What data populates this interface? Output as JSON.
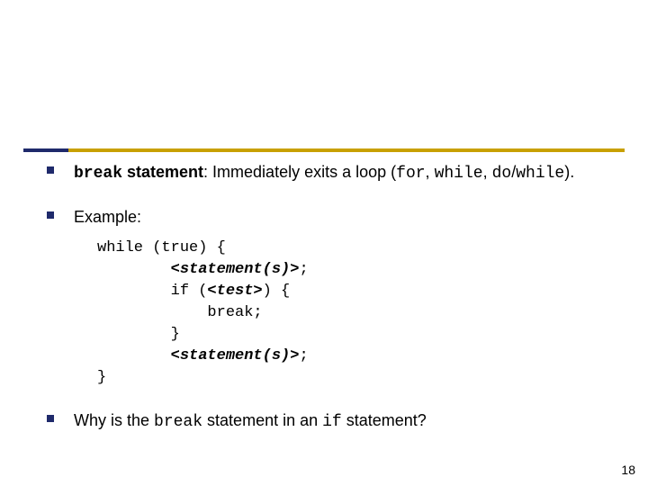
{
  "bullets": {
    "b1": {
      "kw": "break",
      "label": " statement",
      "rest1": ": Immediately exits a loop (",
      "m1": "for",
      "c1": ", ",
      "m2": "while",
      "c2": ", ",
      "m3": "do",
      "slash": "/",
      "m4": "while",
      "rest2": ")."
    },
    "b2": {
      "label": "Example:"
    },
    "code": {
      "l1": "while (true) {",
      "l2": "        <statement(s)>",
      "l2end": ";",
      "l3a": "        if (",
      "l3b": "<test>",
      "l3c": ") {",
      "l4": "            break;",
      "l5": "        }",
      "l6": "        <statement(s)>",
      "l6end": ";",
      "l7": "}"
    },
    "b3": {
      "p1": "Why is the ",
      "kw": "break",
      "p2": " statement in an ",
      "kw2": "if",
      "p3": " statement?"
    }
  },
  "page_number": "18"
}
